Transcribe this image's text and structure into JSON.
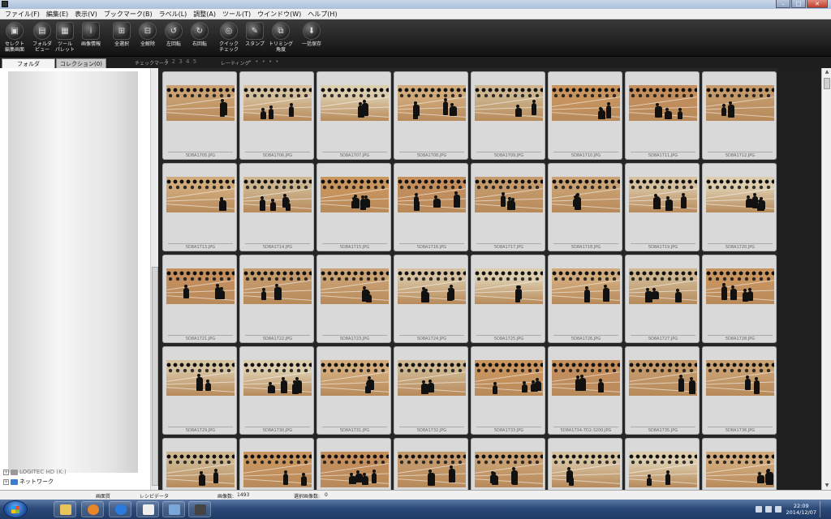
{
  "menu": [
    "ファイル(F)",
    "編集(E)",
    "表示(V)",
    "ブックマーク(B)",
    "ラベル(L)",
    "調整(A)",
    "ツール(T)",
    "ウインドウ(W)",
    "ヘルプ(H)"
  ],
  "window_controls": {
    "minimize": "–",
    "maximize": "□",
    "close": "✕"
  },
  "toolbar": [
    {
      "l1": "セレクト",
      "l2": "編集画面",
      "icon": "select-edit-icon"
    },
    {
      "l1": "フォルダ",
      "l2": "ビュー",
      "icon": "folder-view-icon"
    },
    {
      "l1": "ツール",
      "l2": "パレット",
      "icon": "tool-palette-icon"
    },
    {
      "l1": "画像情報",
      "l2": "",
      "icon": "image-info-icon"
    },
    {
      "l1": "全選択",
      "l2": "",
      "icon": "select-all-icon"
    },
    {
      "l1": "全解除",
      "l2": "",
      "icon": "deselect-all-icon"
    },
    {
      "l1": "左回転",
      "l2": "",
      "icon": "rotate-left-icon"
    },
    {
      "l1": "右回転",
      "l2": "",
      "icon": "rotate-right-icon"
    },
    {
      "l1": "クイック",
      "l2": "チェック",
      "icon": "quick-check-icon"
    },
    {
      "l1": "スタンプ",
      "l2": "",
      "icon": "stamp-icon"
    },
    {
      "l1": "トリミング",
      "l2": "角度",
      "icon": "trim-angle-icon"
    },
    {
      "l1": "一括保存",
      "l2": "",
      "icon": "batch-save-icon"
    }
  ],
  "tabs": {
    "folder": "フォルダ",
    "collection": "コレクション(0)"
  },
  "strip": {
    "checkmark_label": "チェックマーク",
    "checkmark_values": "1 2 3 4 5",
    "rating_label": "レーティング",
    "rating_values": "• • • • •"
  },
  "tree": [
    {
      "label": "LOGITEC HD (K:)",
      "dim": true
    },
    {
      "label": "ネットワーク",
      "dim": false
    }
  ],
  "thumbnails": [
    "5D8A1705.JPG",
    "5D8A1706.JPG",
    "5D8A1707.JPG",
    "5D8A1708.JPG",
    "5D8A1709.JPG",
    "5D8A1710.JPG",
    "5D8A1711.JPG",
    "5D8A1712.JPG",
    "5D8A1713.JPG",
    "5D8A1714.JPG",
    "5D8A1715.JPG",
    "5D8A1716.JPG",
    "5D8A1717.JPG",
    "5D8A1718.JPG",
    "5D8A1719.JPG",
    "5D8A1720.JPG",
    "5D8A1721.JPG",
    "5D8A1722.JPG",
    "5D8A1723.JPG",
    "5D8A1724.JPG",
    "5D8A1725.JPG",
    "5D8A1726.JPG",
    "5D8A1727.JPG",
    "5D8A1728.JPG",
    "5D8A1729.JPG",
    "5D8A1730.JPG",
    "5D8A1731.JPG",
    "5D8A1732.JPG",
    "5D8A1733.JPG",
    "5D8A1734-7D2-3200.JPG",
    "5D8A1735.JPG",
    "5D8A1736.JPG",
    "",
    "",
    "",
    "",
    "",
    "",
    "",
    ""
  ],
  "status": {
    "view": "画面質",
    "recipe": "レシピデータ",
    "count_label": "画像数:",
    "count": "1493",
    "selected_label": "選択画像数:",
    "selected": "0"
  },
  "taskbar": {
    "time": "22:09",
    "date": "2014/12/07"
  },
  "colors": {
    "toolbar": "#1a1a1a",
    "thumb_bg": "#262626",
    "cell": "#d9d9d9",
    "floor_warm": "#c89a6a",
    "floor_pale": "#d7c9a8"
  }
}
